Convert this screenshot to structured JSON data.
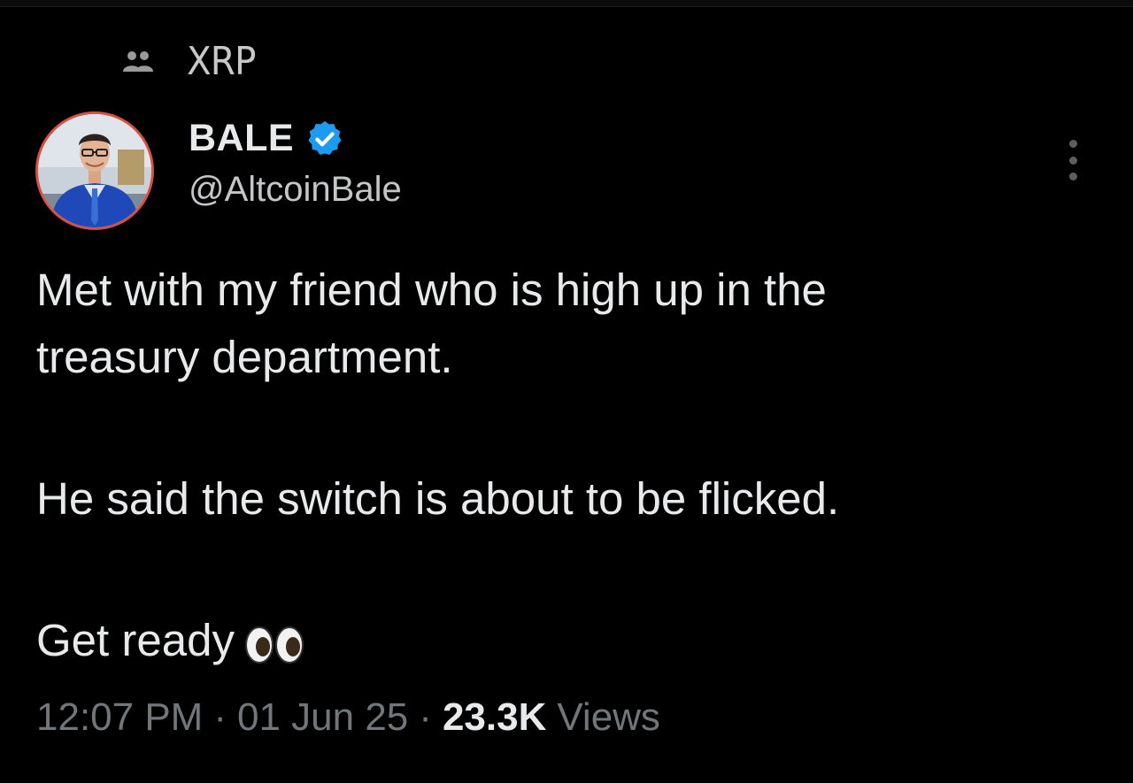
{
  "community": {
    "icon": "community-icon",
    "name": "XRP"
  },
  "author": {
    "display_name": "BALE",
    "handle": "@AltcoinBale",
    "verified_icon": "verified-badge-icon",
    "avatar": "avatar-photo",
    "verified_color": "#1d9bf0"
  },
  "tweet": {
    "lines": [
      "Met with my friend who is high up in the",
      "treasury department.",
      "He said the switch is about to be flicked.",
      "Get ready"
    ],
    "emoji": "eyes-emoji"
  },
  "meta": {
    "time": "12:07 PM",
    "separator": "·",
    "date": "01 Jun 25",
    "views_count": "23.3K",
    "views_label": "Views"
  },
  "colors": {
    "background": "#000000",
    "text_primary": "#e7e9ea",
    "text_secondary": "#71767b"
  }
}
